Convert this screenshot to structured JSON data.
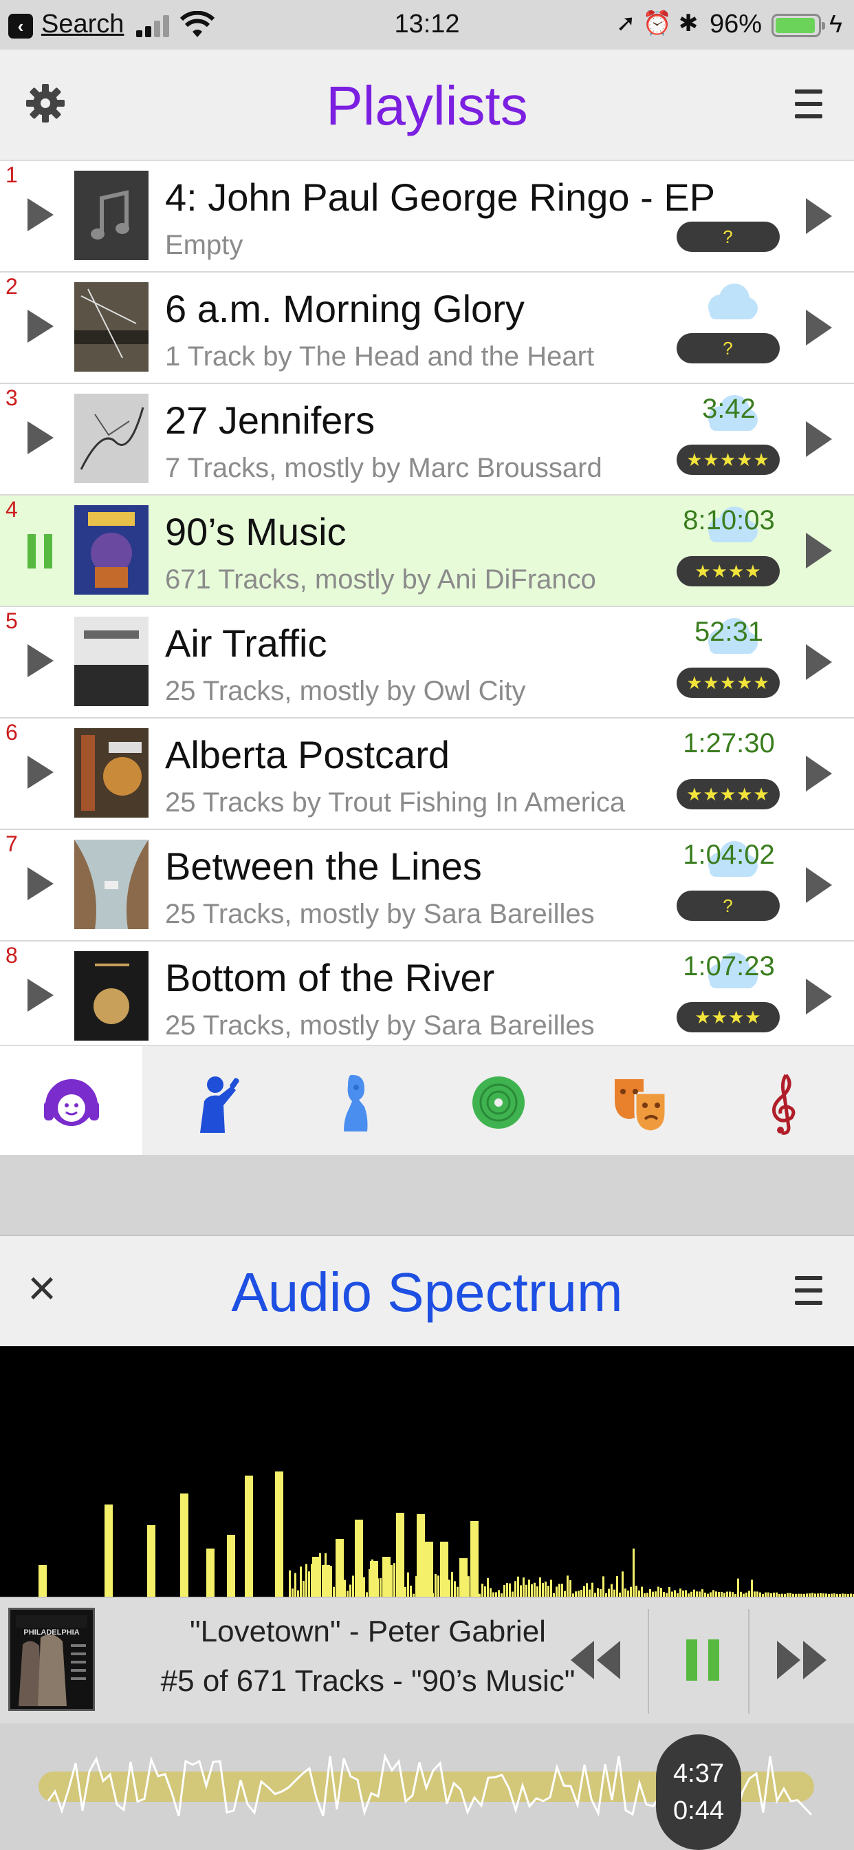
{
  "status_bar": {
    "back_label": "Search",
    "time": "13:12",
    "battery_percent": "96%",
    "battery_level": 0.96,
    "icons": [
      "location-icon",
      "alarm-icon",
      "bluetooth-icon",
      "charging-icon"
    ]
  },
  "playlists_header": {
    "title": "Playlists",
    "left_icon": "gear-icon",
    "right_icon": "menu-icon",
    "title_color": "#7b1fe0"
  },
  "playlists": [
    {
      "index": "1",
      "title": "4: John Paul George Ringo - EP",
      "subtitle": "Empty",
      "duration": "",
      "rating": "?",
      "state": "play",
      "cloud": false
    },
    {
      "index": "2",
      "title": "6 a.m. Morning Glory",
      "subtitle": "1 Track by The Head and the Heart",
      "duration": "",
      "rating": "?",
      "state": "play",
      "cloud": true
    },
    {
      "index": "3",
      "title": "27 Jennifers",
      "subtitle": "7 Tracks, mostly by Marc Broussard",
      "duration": "3:42",
      "rating": "★★★★★",
      "state": "play",
      "cloud": true
    },
    {
      "index": "4",
      "title": "90’s Music",
      "subtitle": "671 Tracks, mostly by Ani DiFranco",
      "duration": "8:10:03",
      "rating": "★★★★",
      "state": "pause",
      "cloud": true
    },
    {
      "index": "5",
      "title": "Air Traffic",
      "subtitle": "25 Tracks, mostly by Owl City",
      "duration": "52:31",
      "rating": "★★★★★",
      "state": "play",
      "cloud": true
    },
    {
      "index": "6",
      "title": "Alberta Postcard",
      "subtitle": "25 Tracks by Trout Fishing In America",
      "duration": "1:27:30",
      "rating": "★★★★★",
      "state": "play",
      "cloud": false
    },
    {
      "index": "7",
      "title": "Between the Lines",
      "subtitle": "25 Tracks, mostly by Sara Bareilles",
      "duration": "1:04:02",
      "rating": "?",
      "state": "play",
      "cloud": true
    },
    {
      "index": "8",
      "title": "Bottom of the River",
      "subtitle": "25 Tracks, mostly by Sara Bareilles",
      "duration": "1:07:23",
      "rating": "★★★★",
      "state": "play",
      "cloud": true
    }
  ],
  "tabs": [
    {
      "name": "listener-icon",
      "active": true
    },
    {
      "name": "singer-icon",
      "active": false
    },
    {
      "name": "composer-icon",
      "active": false
    },
    {
      "name": "album-disc-icon",
      "active": false
    },
    {
      "name": "genre-masks-icon",
      "active": false
    },
    {
      "name": "treble-clef-icon",
      "active": false
    }
  ],
  "spectrum_panel": {
    "title": "Audio Spectrum",
    "close_icon": "close-icon",
    "menu_icon": "menu-icon",
    "title_color": "#1e4fe3",
    "bar_color": "#f4f06a"
  },
  "now_playing": {
    "line1": "\"Lovetown\" - Peter Gabriel",
    "line2": "#5 of 671 Tracks - \"90’s Music\"",
    "cover_text": "PHILADELPHIA",
    "controls": [
      "rewind-icon",
      "pause-icon",
      "fast-forward-icon"
    ]
  },
  "progress": {
    "total_time": "4:37",
    "elapsed_time": "0:44"
  }
}
